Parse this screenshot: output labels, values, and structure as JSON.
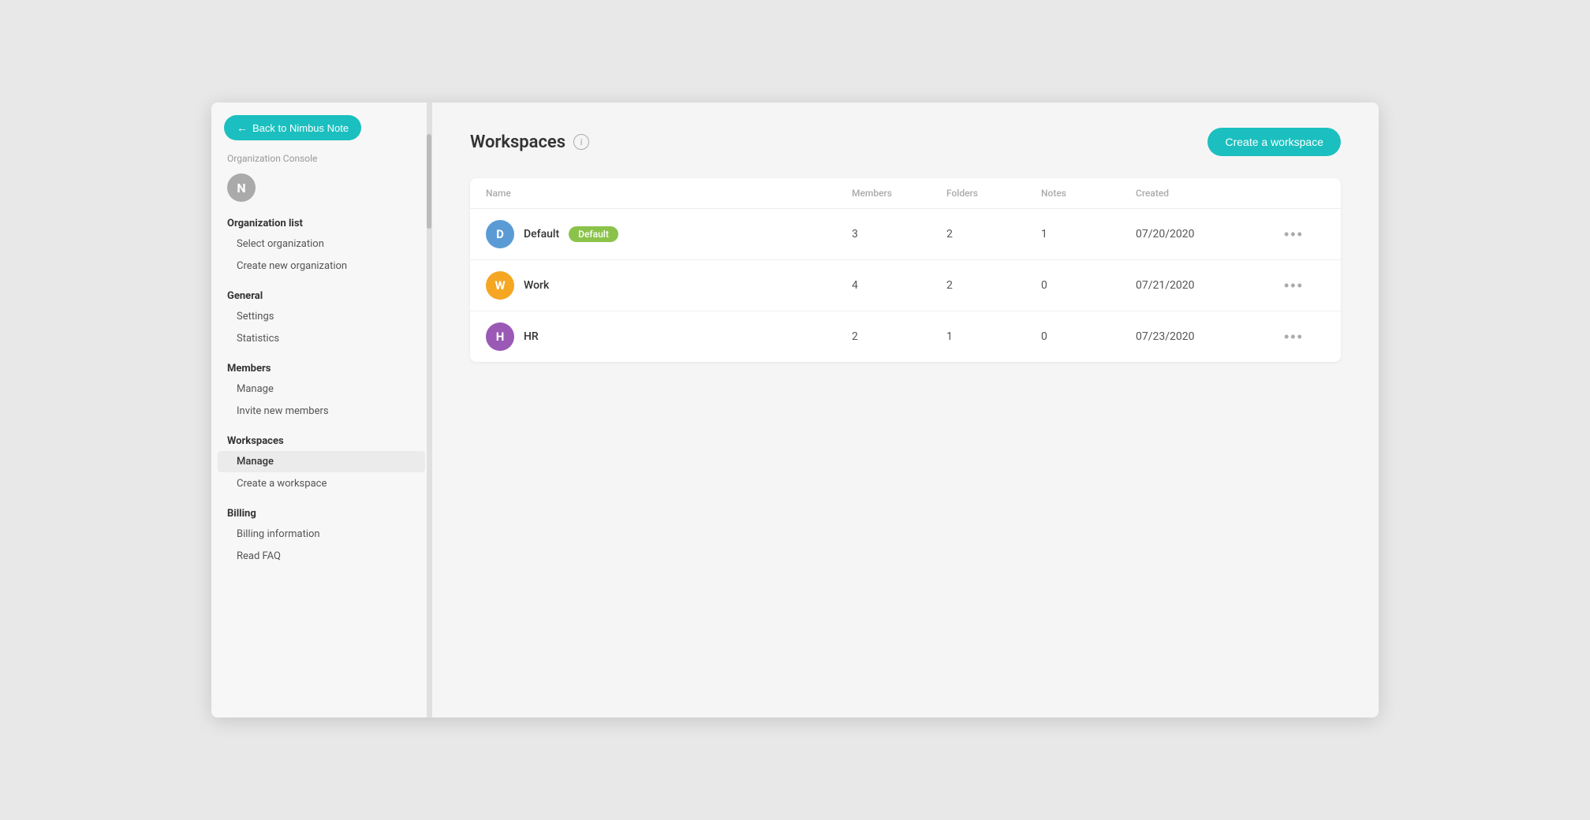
{
  "window": {
    "title": "Organization Console"
  },
  "back_button": {
    "label": "Back to Nimbus Note",
    "arrow": "←"
  },
  "org_console_label": "Organization Console",
  "user_avatar": {
    "letter": "N",
    "color": "#999"
  },
  "sidebar": {
    "sections": [
      {
        "id": "organization",
        "title": "Organization list",
        "items": [
          {
            "id": "select-org",
            "label": "Select organization",
            "active": false
          },
          {
            "id": "create-new-org",
            "label": "Create new organization",
            "active": false
          }
        ]
      },
      {
        "id": "general",
        "title": "General",
        "items": [
          {
            "id": "settings",
            "label": "Settings",
            "active": false
          },
          {
            "id": "statistics",
            "label": "Statistics",
            "active": false
          }
        ]
      },
      {
        "id": "members",
        "title": "Members",
        "items": [
          {
            "id": "manage-members",
            "label": "Manage",
            "active": false
          },
          {
            "id": "invite-members",
            "label": "Invite new members",
            "active": false
          }
        ]
      },
      {
        "id": "workspaces",
        "title": "Workspaces",
        "items": [
          {
            "id": "manage-workspaces",
            "label": "Manage",
            "active": true
          },
          {
            "id": "create-workspace-nav",
            "label": "Create a workspace",
            "active": false
          }
        ]
      },
      {
        "id": "billing",
        "title": "Billing",
        "items": [
          {
            "id": "billing-info",
            "label": "Billing information",
            "active": false
          },
          {
            "id": "read-faq",
            "label": "Read FAQ",
            "active": false
          }
        ]
      }
    ]
  },
  "main": {
    "page_title": "Workspaces",
    "create_button_label": "Create a workspace",
    "table": {
      "headers": [
        "Name",
        "Members",
        "Folders",
        "Notes",
        "Created",
        ""
      ],
      "rows": [
        {
          "id": "default",
          "avatar_letter": "D",
          "avatar_color": "#5b9bd5",
          "name": "Default",
          "badge": "Default",
          "badge_color": "#8bc34a",
          "members": "3",
          "folders": "2",
          "notes": "1",
          "created": "07/20/2020"
        },
        {
          "id": "work",
          "avatar_letter": "W",
          "avatar_color": "#f5a623",
          "name": "Work",
          "badge": null,
          "members": "4",
          "folders": "2",
          "notes": "0",
          "created": "07/21/2020"
        },
        {
          "id": "hr",
          "avatar_letter": "H",
          "avatar_color": "#9b59b6",
          "name": "HR",
          "badge": null,
          "members": "2",
          "folders": "1",
          "notes": "0",
          "created": "07/23/2020"
        }
      ]
    }
  },
  "icons": {
    "more": "•••",
    "info": "i",
    "arrow_left": "←"
  }
}
